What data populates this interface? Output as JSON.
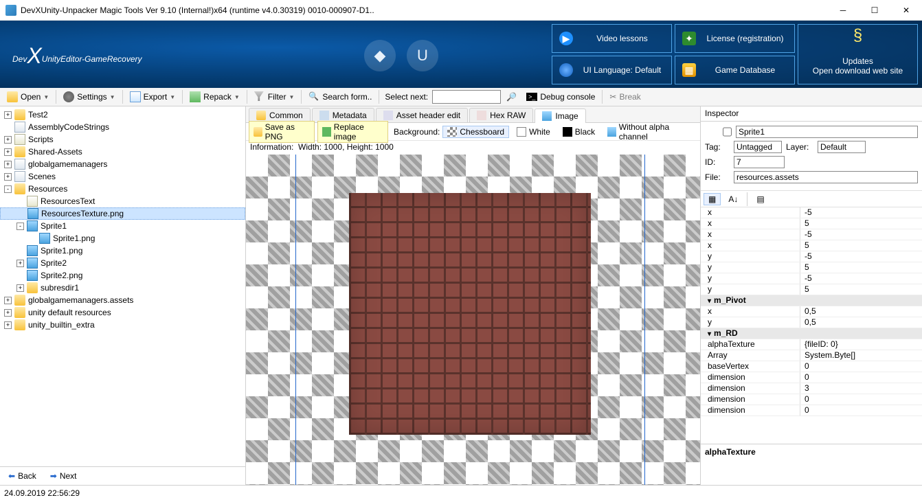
{
  "window": {
    "title": "DevXUnity-Unpacker Magic Tools Ver 9.10 (Internal!)x64 (runtime v4.0.30319) 0010-000907-D1.."
  },
  "header": {
    "logo_prefix": "Dev",
    "logo_mid": "UnityEditor-GameRecovery",
    "video_lessons": "Video lessons",
    "license": "License (registration)",
    "ui_language": "UI Language: Default",
    "game_database": "Game Database",
    "updates_title": "Updates",
    "updates_sub": "Open download web site"
  },
  "toolbar": {
    "open": "Open",
    "settings": "Settings",
    "export": "Export",
    "repack": "Repack",
    "filter": "Filter",
    "search_form": "Search form..",
    "select_next": "Select next:",
    "debug_console": "Debug console",
    "break": "Break"
  },
  "tree": [
    {
      "d": 0,
      "exp": "+",
      "ic": "folder",
      "label": "Test2"
    },
    {
      "d": 0,
      "exp": "",
      "ic": "file",
      "label": "AssemblyCodeStrings"
    },
    {
      "d": 0,
      "exp": "+",
      "ic": "script",
      "label": "Scripts"
    },
    {
      "d": 0,
      "exp": "+",
      "ic": "folder",
      "label": "Shared-Assets"
    },
    {
      "d": 0,
      "exp": "+",
      "ic": "file",
      "label": "globalgamemanagers"
    },
    {
      "d": 0,
      "exp": "+",
      "ic": "file",
      "label": "Scenes"
    },
    {
      "d": 0,
      "exp": "-",
      "ic": "folder",
      "label": "Resources"
    },
    {
      "d": 1,
      "exp": "",
      "ic": "script",
      "label": "ResourcesText"
    },
    {
      "d": 1,
      "exp": "",
      "ic": "img",
      "label": "ResourcesTexture.png",
      "sel": true
    },
    {
      "d": 1,
      "exp": "-",
      "ic": "img",
      "label": "Sprite1"
    },
    {
      "d": 2,
      "exp": "",
      "ic": "img",
      "label": "Sprite1.png"
    },
    {
      "d": 1,
      "exp": "",
      "ic": "img",
      "label": "Sprite1.png"
    },
    {
      "d": 1,
      "exp": "+",
      "ic": "img",
      "label": "Sprite2"
    },
    {
      "d": 1,
      "exp": "",
      "ic": "img",
      "label": "Sprite2.png"
    },
    {
      "d": 1,
      "exp": "+",
      "ic": "folder",
      "label": "subresdir1"
    },
    {
      "d": 0,
      "exp": "+",
      "ic": "folder",
      "label": "globalgamemanagers.assets"
    },
    {
      "d": 0,
      "exp": "+",
      "ic": "folder",
      "label": "unity default resources"
    },
    {
      "d": 0,
      "exp": "+",
      "ic": "folder",
      "label": "unity_builtin_extra"
    }
  ],
  "nav": {
    "back": "Back",
    "next": "Next"
  },
  "center": {
    "tabs": {
      "common": "Common",
      "metadata": "Metadata",
      "asset_header": "Asset header edit",
      "hex": "Hex RAW",
      "image": "Image"
    },
    "save_png": "Save as PNG",
    "replace": "Replace image",
    "background": "Background:",
    "chessboard": "Chessboard",
    "white": "White",
    "black": "Black",
    "noalpha": "Without alpha channel",
    "info_label": "Information:",
    "info_value": "Width: 1000, Height: 1000"
  },
  "inspector": {
    "title": "Inspector",
    "name": "Sprite1",
    "tag_label": "Tag:",
    "tag": "Untagged",
    "layer_label": "Layer:",
    "layer": "Default",
    "id_label": "ID:",
    "id": "7",
    "file_label": "File:",
    "file": "resources.assets",
    "footer": "alphaTexture"
  },
  "props": [
    {
      "k": "x",
      "v": "-5"
    },
    {
      "k": "x",
      "v": "5"
    },
    {
      "k": "x",
      "v": "-5"
    },
    {
      "k": "x",
      "v": "5"
    },
    {
      "k": "y",
      "v": "-5"
    },
    {
      "k": "y",
      "v": "5"
    },
    {
      "k": "y",
      "v": "-5"
    },
    {
      "k": "y",
      "v": "5"
    },
    {
      "group": "m_Pivot"
    },
    {
      "k": "x",
      "v": "0,5"
    },
    {
      "k": "y",
      "v": "0,5"
    },
    {
      "group": "m_RD"
    },
    {
      "k": "alphaTexture",
      "v": "{fileID: 0}"
    },
    {
      "k": "Array",
      "v": "System.Byte[]"
    },
    {
      "k": "baseVertex",
      "v": "0"
    },
    {
      "k": "dimension",
      "v": "0"
    },
    {
      "k": "dimension",
      "v": "3"
    },
    {
      "k": "dimension",
      "v": "0"
    },
    {
      "k": "dimension",
      "v": "0"
    }
  ],
  "status": {
    "timestamp": "24.09.2019 22:56:29"
  }
}
